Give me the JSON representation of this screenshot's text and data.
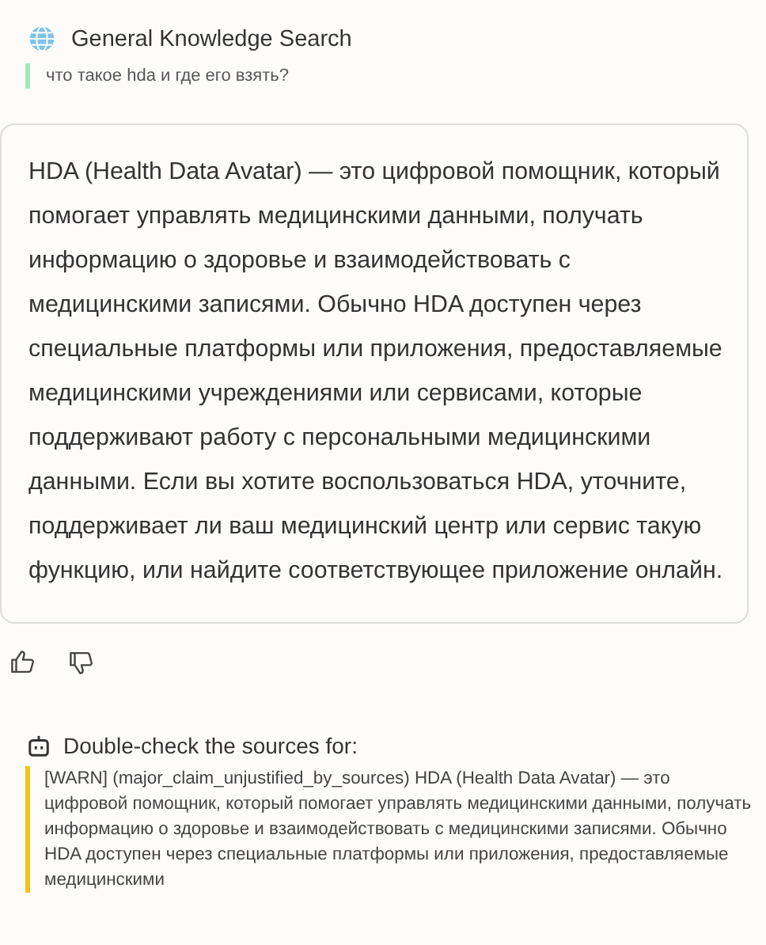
{
  "source": {
    "title": "General Knowledge Search",
    "query": "что такое hda и где его взять?"
  },
  "answer": "HDA (Health Data Avatar) — это цифровой помощник, который помогает управлять медицинскими данными, получать информацию о здоровье и взаимодействовать с медицинскими записями. Обычно HDA доступен через специальные платформы или приложения, предоставляемые медицинскими учреждениями или сервисами, которые поддерживают работу с персональными медицинскими данными. Если вы хотите воспользоваться HDA, уточните, поддерживает ли ваш медицинский центр или сервис такую функцию, или найдите соответствующее приложение онлайн.",
  "feedback": [
    {
      "kind": "like",
      "selected": false
    },
    {
      "kind": "dislike",
      "selected": false
    }
  ],
  "check": {
    "title": "Double-check the sources for:",
    "warning": "[WARN] (major_claim_unjustified_by_sources) HDA (Health Data Avatar) — это цифровой помощник, который помогает управлять медицинскими данными, получать информацию о здоровье и взаимодействовать с медицинскими записями. Обычно HDA доступен через специальные платформы или приложения, предоставляемые медицинскими"
  }
}
